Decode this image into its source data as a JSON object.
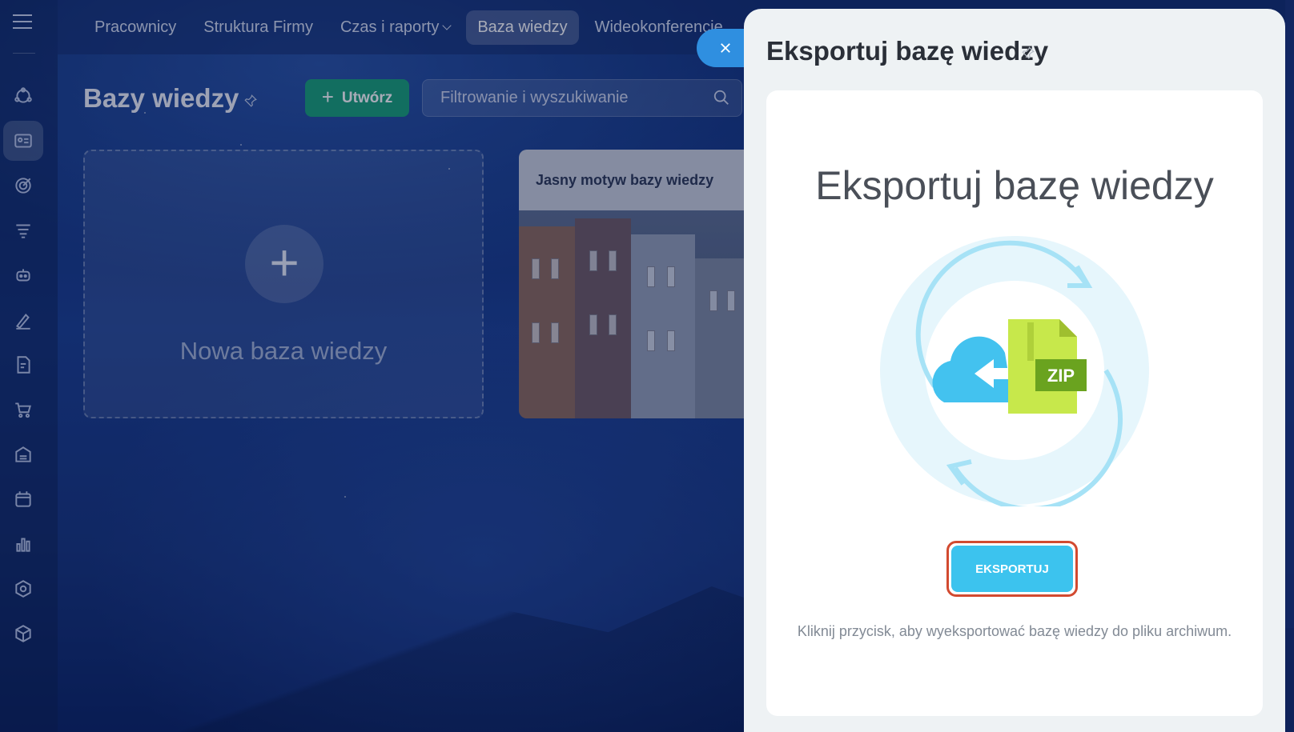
{
  "topnav": {
    "tabs": [
      {
        "label": "Pracownicy"
      },
      {
        "label": "Struktura Firmy"
      },
      {
        "label": "Czas i raporty"
      },
      {
        "label": "Baza wiedzy"
      },
      {
        "label": "Wideokonferencje"
      }
    ]
  },
  "page": {
    "title": "Bazy wiedzy",
    "create_label": "Utwórz",
    "search_placeholder": "Filtrowanie i wyszukiwanie"
  },
  "cards": {
    "new_label": "Nowa baza wiedzy",
    "theme_title": "Jasny motyw bazy wiedzy"
  },
  "panel": {
    "title": "Eksportuj bazę wiedzy",
    "body_title": "Eksportuj bazę wiedzy",
    "zip_label": "ZIP",
    "export_button": "EKSPORTUJ",
    "hint": "Kliknij przycisk, aby wyeksportować bazę wiedzy do pliku archiwum."
  },
  "colors": {
    "create_button": "#1aa17a",
    "export_button": "#3cc3ee",
    "export_highlight": "#d24a30",
    "close_button": "#2f8fe0"
  }
}
